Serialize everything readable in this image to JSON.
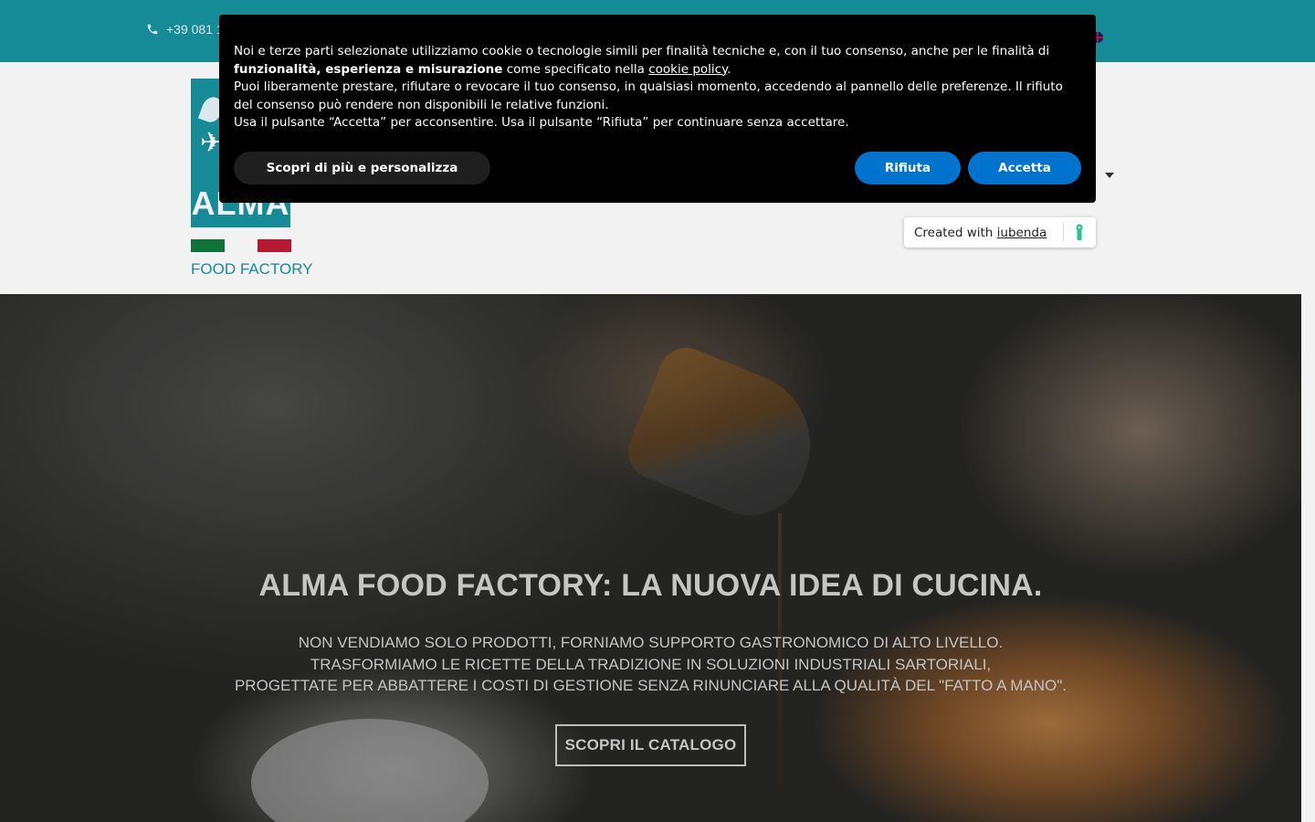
{
  "topbar": {
    "phone": "+39 081 1",
    "phone_icon": "phone-icon",
    "language_icon": "uk-flag-icon"
  },
  "logo": {
    "word": "ALMA",
    "tagline": "FOOD FACTORY"
  },
  "hero": {
    "title": "ALMA FOOD FACTORY: LA NUOVA IDEA DI CUCINA.",
    "subtitle_lines": [
      "NON VENDIAMO SOLO PRODOTTI, FORNIAMO SUPPORTO GASTRONOMICO DI ALTO LIVELLO.",
      "TRASFORMIAMO LE RICETTE DELLA TRADIZIONE IN SOLUZIONI INDUSTRIALI SARTORIALI,",
      "PROGETTATE PER ABBATTERE I COSTI DI GESTIONE SENZA RINUNCIARE ALLA QUALITÀ DEL \"FATTO A MANO\"."
    ],
    "cta": "SCOPRI IL CATALOGO"
  },
  "cookie": {
    "p1_before": "Noi e terze parti selezionate utilizziamo cookie o tecnologie simili per finalità tecniche e, con il tuo consenso, anche per le finalità di ",
    "p1_bold": "funzionalità, esperienza e misurazione",
    "p1_after": " come specificato nella ",
    "p1_link": "cookie policy",
    "p1_end": ".",
    "p2": "Puoi liberamente prestare, rifiutare o revocare il tuo consenso, in qualsiasi momento, accedendo al pannello delle preferenze. Il rifiuto del consenso può rendere non disponibili le relative funzioni.",
    "p3": "Usa il pulsante “Accetta” per acconsentire. Usa il pulsante “Rifiuta” per continuare senza accettare.",
    "btn_more": "Scopri di più e personalizza",
    "btn_reject": "Rifiuta",
    "btn_accept": "Accetta"
  },
  "iubenda": {
    "prefix": "Created with ",
    "link": "iubenda"
  },
  "colors": {
    "brand_teal": "#1793a0",
    "button_blue": "#0073ce",
    "flag_green": "#0f7a3b",
    "flag_red": "#c11a35"
  }
}
